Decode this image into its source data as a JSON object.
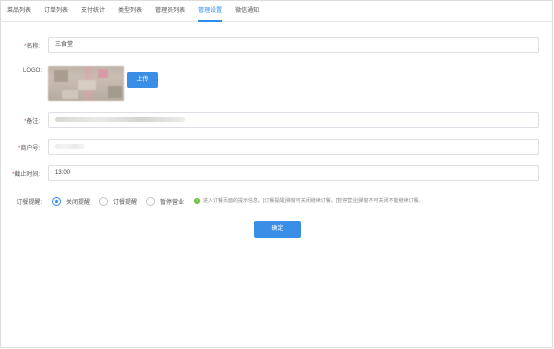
{
  "tabs": [
    {
      "label": "菜品列表",
      "active": false
    },
    {
      "label": "订单列表",
      "active": false
    },
    {
      "label": "支付统计",
      "active": false
    },
    {
      "label": "类型列表",
      "active": false
    },
    {
      "label": "管理员列表",
      "active": false
    },
    {
      "label": "管理设置",
      "active": true
    },
    {
      "label": "微信通知",
      "active": false
    }
  ],
  "form": {
    "name": {
      "required_mark": "*",
      "label": "名称:",
      "value": "三食堂"
    },
    "logo": {
      "label": "LOGO:",
      "upload_label": "上传"
    },
    "remark": {
      "required_mark": "*",
      "label": "备注:"
    },
    "merchant_no": {
      "required_mark": "*",
      "label": "商户号:"
    },
    "deadline": {
      "required_mark": "*",
      "label": "截止时间:",
      "value": "13:00"
    },
    "order_notice": {
      "label": "订餐提醒:",
      "options": [
        {
          "label": "关闭提醒",
          "checked": true
        },
        {
          "label": "订餐提醒",
          "checked": false
        },
        {
          "label": "暂停营业",
          "checked": false
        }
      ],
      "tip": "进入订餐页面的提示信息。[订餐提醒]弹窗可关闭继续订餐。[暂停营业]弹窗不可关闭不能继续订餐。"
    },
    "confirm_label": "确定"
  },
  "colors": {
    "accent": "#2d8cf0",
    "button": "#3a8ee6",
    "required": "#e64c3b",
    "tip_icon": "#67c23a"
  }
}
